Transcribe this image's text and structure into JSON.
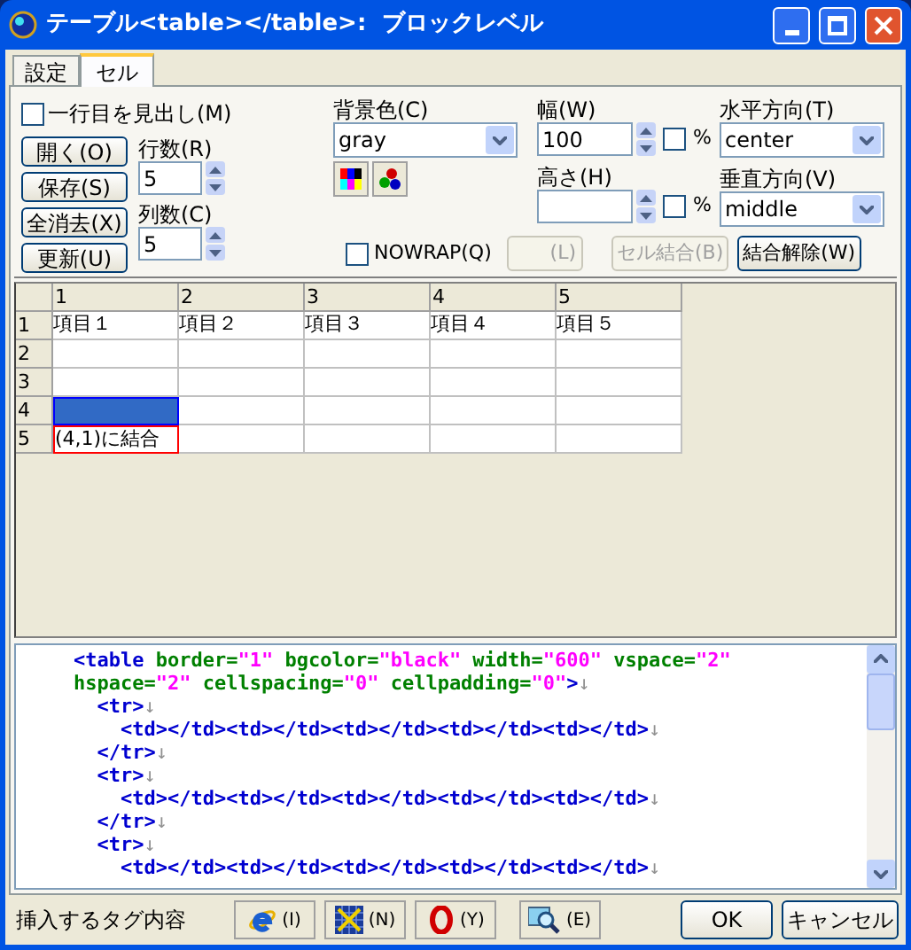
{
  "window": {
    "title": "テーブル<table></table>:  ブロックレベル"
  },
  "tabs": [
    {
      "label": "設定",
      "selected": false
    },
    {
      "label": "セル",
      "selected": true
    }
  ],
  "header_row_checkbox": {
    "label": "一行目を見出し(M)",
    "checked": false
  },
  "file_buttons": [
    "開く(O)",
    "保存(S)",
    "全消去(X)",
    "更新(U)"
  ],
  "rows_field": {
    "label": "行数(R)",
    "value": "5"
  },
  "cols_field": {
    "label": "列数(C)",
    "value": "5"
  },
  "background_color": {
    "label": "背景色(C)",
    "value": "gray"
  },
  "width": {
    "label": "幅(W)",
    "value": "100",
    "percent": {
      "label": "%",
      "checked": false
    }
  },
  "height": {
    "label": "高さ(H)",
    "percent": {
      "label": "%",
      "checked": false
    }
  },
  "horizontal_align": {
    "label": "水平方向(T)",
    "value": "center"
  },
  "vertical_align": {
    "label": "垂直方向(V)",
    "value": "middle"
  },
  "nowrap": {
    "label": "NOWRAP(Q)",
    "checked": false
  },
  "cell_buttons": [
    {
      "label": "(L)",
      "disabled": true,
      "kind": "blank"
    },
    {
      "label": "セル結合(B)",
      "disabled": true,
      "kind": "text"
    },
    {
      "label": "結合解除(W)",
      "disabled": false,
      "kind": "text"
    }
  ],
  "grid": {
    "columns": [
      "1",
      "2",
      "3",
      "4",
      "5"
    ],
    "rows": [
      {
        "header": "1",
        "cells": [
          {
            "text": "項目１",
            "selected": false,
            "kind": "normal"
          },
          {
            "text": "項目２",
            "selected": false,
            "kind": "normal"
          },
          {
            "text": "項目３",
            "selected": false,
            "kind": "normal"
          },
          {
            "text": "項目４",
            "selected": false,
            "kind": "normal"
          },
          {
            "text": "項目５",
            "selected": false,
            "kind": "normal"
          }
        ]
      },
      {
        "header": "2",
        "cells": [
          {
            "selected": false,
            "kind": "normal"
          },
          {
            "selected": false,
            "kind": "normal"
          },
          {
            "selected": false,
            "kind": "normal"
          },
          {
            "selected": false,
            "kind": "normal"
          },
          {
            "selected": false,
            "kind": "normal"
          }
        ]
      },
      {
        "header": "3",
        "cells": [
          {
            "selected": false,
            "kind": "normal"
          },
          {
            "selected": false,
            "kind": "normal"
          },
          {
            "selected": false,
            "kind": "normal"
          },
          {
            "selected": false,
            "kind": "normal"
          },
          {
            "selected": false,
            "kind": "normal"
          }
        ]
      },
      {
        "header": "4",
        "cells": [
          {
            "selected": true,
            "kind": "normal"
          },
          {
            "selected": false,
            "kind": "normal"
          },
          {
            "selected": false,
            "kind": "normal"
          },
          {
            "selected": false,
            "kind": "normal"
          },
          {
            "selected": false,
            "kind": "normal"
          }
        ]
      },
      {
        "header": "5",
        "cells": [
          {
            "text": "(4,1)に結合",
            "selected": false,
            "kind": "merged"
          },
          {
            "selected": false,
            "kind": "normal"
          },
          {
            "selected": false,
            "kind": "normal"
          },
          {
            "selected": false,
            "kind": "normal"
          },
          {
            "selected": false,
            "kind": "normal"
          }
        ]
      }
    ]
  },
  "code_lines": [
    [
      {
        "kind": "tag",
        "text": "    <table"
      },
      {
        "kind": "attr",
        "text": " border="
      },
      {
        "kind": "value",
        "text": "\"1\""
      },
      {
        "kind": "attr",
        "text": " bgcolor="
      },
      {
        "kind": "value",
        "text": "\"black\""
      },
      {
        "kind": "attr",
        "text": " width="
      },
      {
        "kind": "value",
        "text": "\"600\""
      },
      {
        "kind": "attr",
        "text": " vspace="
      },
      {
        "kind": "value",
        "text": "\"2\""
      }
    ],
    [
      {
        "kind": "attr",
        "text": "    hspace="
      },
      {
        "kind": "value",
        "text": "\"2\""
      },
      {
        "kind": "attr",
        "text": " cellspacing="
      },
      {
        "kind": "value",
        "text": "\"0\""
      },
      {
        "kind": "attr",
        "text": " cellpadding="
      },
      {
        "kind": "value",
        "text": "\"0\""
      },
      {
        "kind": "tag",
        "text": ">"
      },
      {
        "kind": "eol",
        "text": "↓"
      }
    ],
    [
      {
        "kind": "tag",
        "text": "      <tr>"
      },
      {
        "kind": "eol",
        "text": "↓"
      }
    ],
    [
      {
        "kind": "tag",
        "text": "        <td></td><td></td><td></td><td></td><td></td>"
      },
      {
        "kind": "eol",
        "text": "↓"
      }
    ],
    [
      {
        "kind": "tag",
        "text": "      </tr>"
      },
      {
        "kind": "eol",
        "text": "↓"
      }
    ],
    [
      {
        "kind": "tag",
        "text": "      <tr>"
      },
      {
        "kind": "eol",
        "text": "↓"
      }
    ],
    [
      {
        "kind": "tag",
        "text": "        <td></td><td></td><td></td><td></td><td></td>"
      },
      {
        "kind": "eol",
        "text": "↓"
      }
    ],
    [
      {
        "kind": "tag",
        "text": "      </tr>"
      },
      {
        "kind": "eol",
        "text": "↓"
      }
    ],
    [
      {
        "kind": "tag",
        "text": "      <tr>"
      },
      {
        "kind": "eol",
        "text": "↓"
      }
    ],
    [
      {
        "kind": "tag",
        "text": "        <td></td><td></td><td></td><td></td><td></td>"
      },
      {
        "kind": "eol",
        "text": "↓"
      }
    ]
  ],
  "bottom_bar": {
    "label": "挿入するタグ内容",
    "preview_buttons": [
      {
        "kind": "ie",
        "label": "(I)"
      },
      {
        "kind": "netscape",
        "label": "(N)"
      },
      {
        "kind": "opera",
        "label": "(Y)"
      },
      {
        "kind": "preview",
        "label": "(E)"
      }
    ],
    "ok": "OK",
    "cancel": "キャンセル"
  }
}
